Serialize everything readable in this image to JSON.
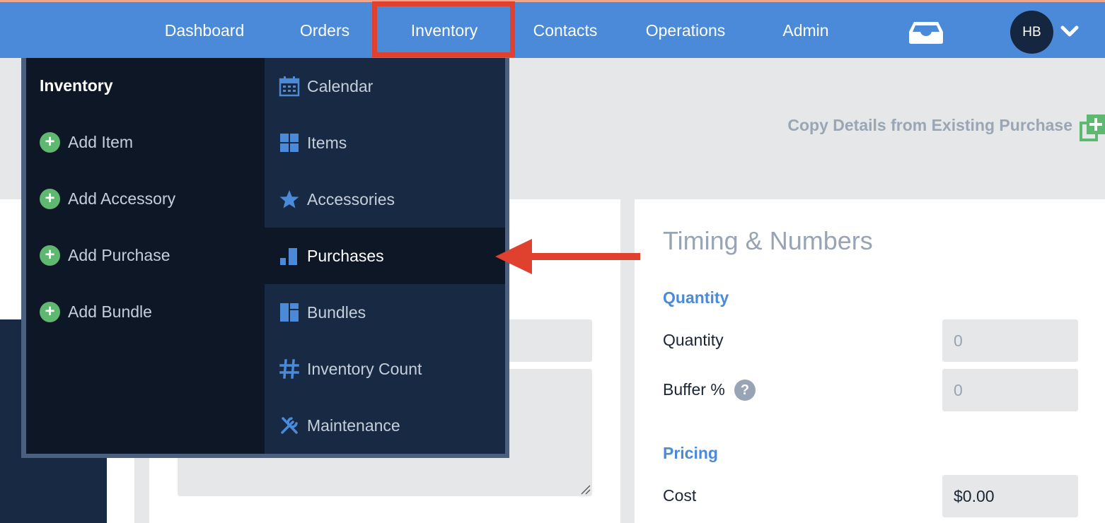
{
  "nav": {
    "items": [
      {
        "label": "Dashboard"
      },
      {
        "label": "Orders"
      },
      {
        "label": "Inventory"
      },
      {
        "label": "Contacts"
      },
      {
        "label": "Operations"
      },
      {
        "label": "Admin"
      }
    ],
    "avatar_initials": "HB"
  },
  "page": {
    "copy_link": "Copy Details from Existing Purchase",
    "panel_title": "Timing & Numbers",
    "sections": {
      "quantity": "Quantity",
      "pricing": "Pricing"
    },
    "fields": [
      {
        "label": "Quantity",
        "value": "0"
      },
      {
        "label": "Buffer %",
        "value": "0"
      },
      {
        "label": "Cost",
        "value": "$0.00"
      }
    ]
  },
  "dropdown": {
    "heading": "Inventory",
    "add_items": [
      {
        "label": "Add Item"
      },
      {
        "label": "Add Accessory"
      },
      {
        "label": "Add Purchase"
      },
      {
        "label": "Add Bundle"
      }
    ],
    "links": [
      {
        "label": "Calendar",
        "icon": "calendar-icon"
      },
      {
        "label": "Items",
        "icon": "grid-icon"
      },
      {
        "label": "Accessories",
        "icon": "star-icon"
      },
      {
        "label": "Purchases",
        "icon": "bar-chart-icon",
        "active": true
      },
      {
        "label": "Bundles",
        "icon": "bundle-icon"
      },
      {
        "label": "Inventory Count",
        "icon": "hash-icon"
      },
      {
        "label": "Maintenance",
        "icon": "tools-icon"
      }
    ]
  },
  "colors": {
    "nav_bg": "#4a8ad8",
    "highlight": "#e0412e",
    "dropdown_dark": "#0d1726",
    "dropdown_mid": "#182a43",
    "plus_green": "#5fb86f",
    "section_blue": "#4a8ad8"
  }
}
